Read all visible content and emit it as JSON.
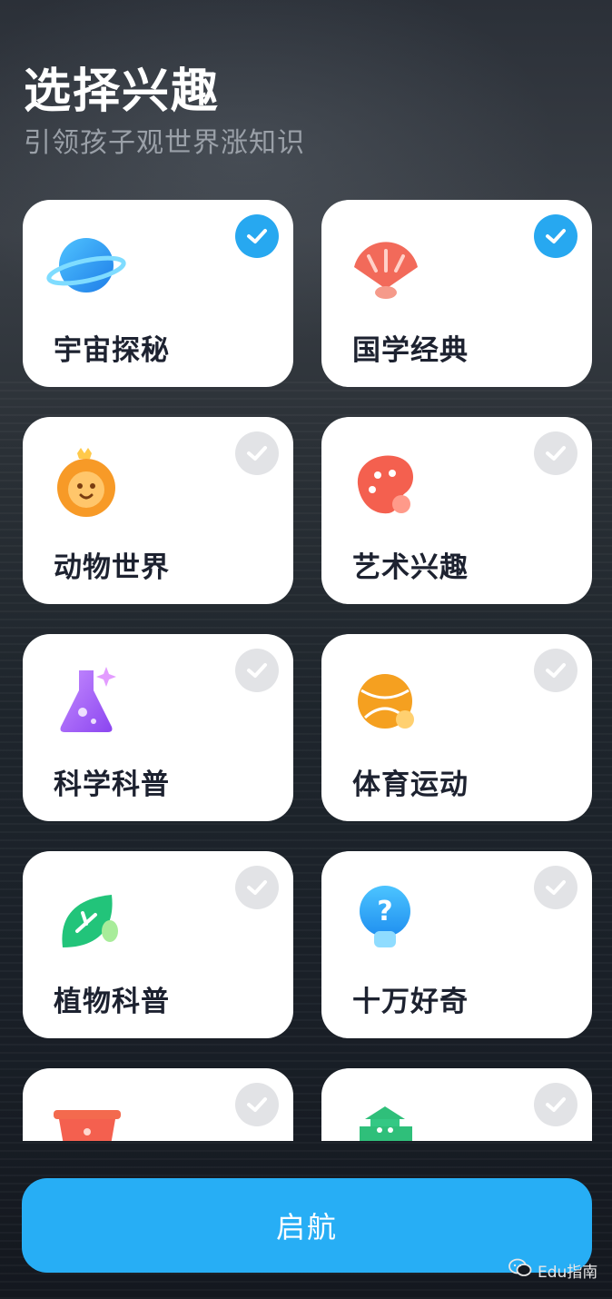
{
  "header": {
    "title": "选择兴趣",
    "subtitle": "引领孩子观世界涨知识"
  },
  "interests": [
    {
      "label": "宇宙探秘",
      "icon": "planet-icon",
      "selected": true
    },
    {
      "label": "国学经典",
      "icon": "fan-icon",
      "selected": true
    },
    {
      "label": "动物世界",
      "icon": "lion-icon",
      "selected": false
    },
    {
      "label": "艺术兴趣",
      "icon": "palette-icon",
      "selected": false
    },
    {
      "label": "科学科普",
      "icon": "flask-icon",
      "selected": false
    },
    {
      "label": "体育运动",
      "icon": "ball-icon",
      "selected": false
    },
    {
      "label": "植物科普",
      "icon": "leaf-icon",
      "selected": false
    },
    {
      "label": "十万好奇",
      "icon": "lightbulb-icon",
      "selected": false
    },
    {
      "label": "",
      "icon": "pot-icon",
      "selected": false
    },
    {
      "label": "",
      "icon": "building-icon",
      "selected": false
    }
  ],
  "colors": {
    "accent": "#27aef5",
    "check_selected": "#27a8f0",
    "check_unselected": "#e2e3e6",
    "card_bg": "#ffffff",
    "label_text": "#1d2230"
  },
  "start_button": {
    "label": "启航"
  },
  "watermark": {
    "text": "Edu指南",
    "icon": "wechat-icon"
  }
}
